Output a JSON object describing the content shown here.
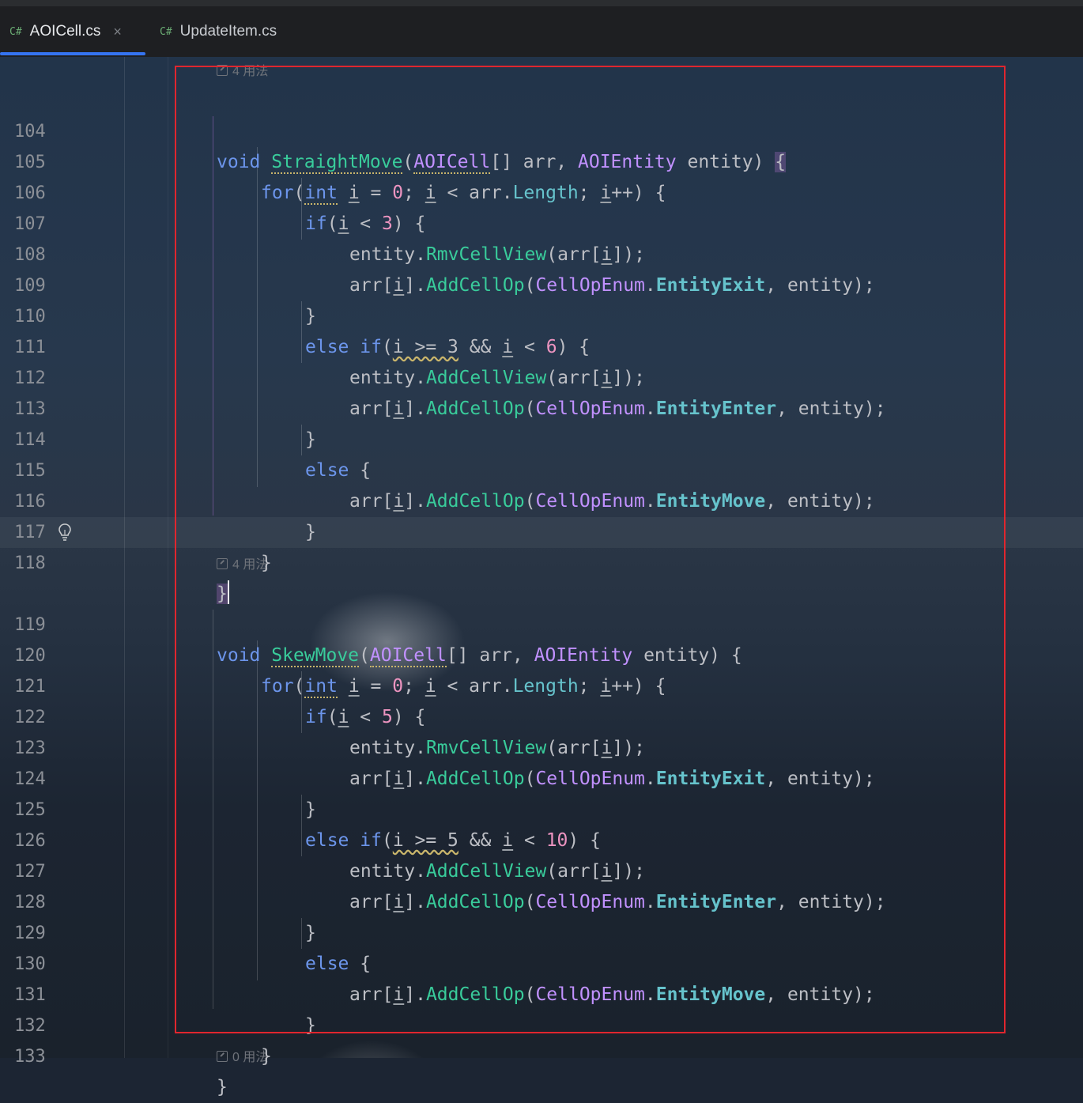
{
  "tabs": [
    {
      "lang": "C#",
      "label": "AOICell.cs",
      "active": true,
      "close": "×"
    },
    {
      "lang": "C#",
      "label": "UpdateItem.cs",
      "active": false
    }
  ],
  "hints": [
    {
      "icon": "usage-icon",
      "text": "4 用法"
    },
    {
      "icon": "usage-icon",
      "text": "4 用法"
    },
    {
      "icon": "usage-icon",
      "text": "0 用法"
    }
  ],
  "code": {
    "l104": {
      "num": "104",
      "kw_void": "void",
      "method": "StraightMove",
      "p1": "(",
      "t1": "AOICell",
      "p2": "[] arr, ",
      "t2": "AOIEntity",
      "p3": " entity) ",
      "brace": "{"
    },
    "l105": {
      "num": "105",
      "kw_for": "for",
      "p1": "(",
      "t_int": "int",
      "v1": "i",
      "p2": " = ",
      "n0": "0",
      "p3": "; ",
      "v2": "i",
      "p4": " < arr.",
      "prop": "Length",
      "p5": "; ",
      "v3": "i",
      "p6": "++) {"
    },
    "l106": {
      "num": "106",
      "kw": "if",
      "p1": "(",
      "v": "i",
      "p2": " < ",
      "n": "3",
      "p3": ") {"
    },
    "l107": {
      "num": "107",
      "p1": "entity.",
      "m": "RmvCellView",
      "p2": "(arr[",
      "v": "i",
      "p3": "]);"
    },
    "l108": {
      "num": "108",
      "p1": "arr[",
      "v": "i",
      "p2": "].",
      "m": "AddCellOp",
      "p3": "(",
      "cls": "CellOpEnum",
      "p4": ".",
      "enm": "EntityExit",
      "p5": ", entity);"
    },
    "l109": {
      "num": "109",
      "p1": "}"
    },
    "l110": {
      "num": "110",
      "kw1": "else",
      "kw2": "if",
      "p1": "(",
      "w": "i >= 3",
      "p2": " && ",
      "v": "i",
      "p3": " < ",
      "n": "6",
      "p4": ") {"
    },
    "l111": {
      "num": "111",
      "p1": "entity.",
      "m": "AddCellView",
      "p2": "(arr[",
      "v": "i",
      "p3": "]);"
    },
    "l112": {
      "num": "112",
      "p1": "arr[",
      "v": "i",
      "p2": "].",
      "m": "AddCellOp",
      "p3": "(",
      "cls": "CellOpEnum",
      "p4": ".",
      "enm": "EntityEnter",
      "p5": ", entity);"
    },
    "l113": {
      "num": "113",
      "p1": "}"
    },
    "l114": {
      "num": "114",
      "kw": "else",
      "p1": " {"
    },
    "l115": {
      "num": "115",
      "p1": "arr[",
      "v": "i",
      "p2": "].",
      "m": "AddCellOp",
      "p3": "(",
      "cls": "CellOpEnum",
      "p4": ".",
      "enm": "EntityMove",
      "p5": ", entity);"
    },
    "l116": {
      "num": "116",
      "p1": "}"
    },
    "l117": {
      "num": "117",
      "p1": "}"
    },
    "l118": {
      "num": "118",
      "p1": "}"
    },
    "l119": {
      "num": "119",
      "kw_void": "void",
      "method": "SkewMove",
      "p1": "(",
      "t1": "AOICell",
      "p2": "[] arr, ",
      "t2": "AOIEntity",
      "p3": " entity) {"
    },
    "l120": {
      "num": "120",
      "kw_for": "for",
      "p1": "(",
      "t_int": "int",
      "v1": "i",
      "p2": " = ",
      "n0": "0",
      "p3": "; ",
      "v2": "i",
      "p4": " < arr.",
      "prop": "Length",
      "p5": "; ",
      "v3": "i",
      "p6": "++) {"
    },
    "l121": {
      "num": "121",
      "kw": "if",
      "p1": "(",
      "v": "i",
      "p2": " < ",
      "n": "5",
      "p3": ") {"
    },
    "l122": {
      "num": "122",
      "p1": "entity.",
      "m": "RmvCellView",
      "p2": "(arr[",
      "v": "i",
      "p3": "]);"
    },
    "l123": {
      "num": "123",
      "p1": "arr[",
      "v": "i",
      "p2": "].",
      "m": "AddCellOp",
      "p3": "(",
      "cls": "CellOpEnum",
      "p4": ".",
      "enm": "EntityExit",
      "p5": ", entity);"
    },
    "l124": {
      "num": "124",
      "p1": "}"
    },
    "l125": {
      "num": "125",
      "kw1": "else",
      "kw2": "if",
      "p1": "(",
      "w": "i >= 5",
      "p2": " && ",
      "v": "i",
      "p3": " < ",
      "n": "10",
      "p4": ") {"
    },
    "l126": {
      "num": "126",
      "p1": "entity.",
      "m": "AddCellView",
      "p2": "(arr[",
      "v": "i",
      "p3": "]);"
    },
    "l127": {
      "num": "127",
      "p1": "arr[",
      "v": "i",
      "p2": "].",
      "m": "AddCellOp",
      "p3": "(",
      "cls": "CellOpEnum",
      "p4": ".",
      "enm": "EntityEnter",
      "p5": ", entity);"
    },
    "l128": {
      "num": "128",
      "p1": "}"
    },
    "l129": {
      "num": "129",
      "kw": "else",
      "p1": " {"
    },
    "l130": {
      "num": "130",
      "p1": "arr[",
      "v": "i",
      "p2": "].",
      "m": "AddCellOp",
      "p3": "(",
      "cls": "CellOpEnum",
      "p4": ".",
      "enm": "EntityMove",
      "p5": ", entity);"
    },
    "l131": {
      "num": "131",
      "p1": "}"
    },
    "l132": {
      "num": "132",
      "p1": "}"
    },
    "l133": {
      "num": "133",
      "p1": "}"
    }
  },
  "colors": {
    "keyword": "#6c95eb",
    "method": "#39cc9b",
    "class": "#c191ff",
    "number": "#ed94c0",
    "enum_member": "#66c3cc",
    "selection_box": "#e0262e",
    "active_tab_underline": "#3574f0"
  }
}
